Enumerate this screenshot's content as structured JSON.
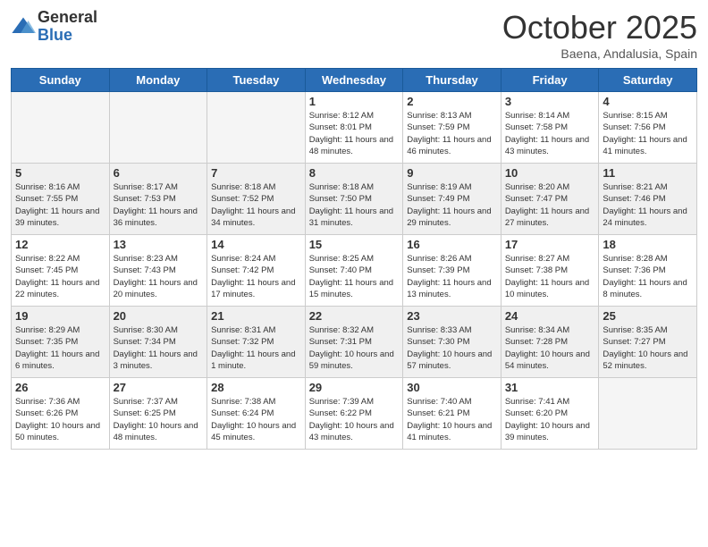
{
  "header": {
    "logo_general": "General",
    "logo_blue": "Blue",
    "month_title": "October 2025",
    "subtitle": "Baena, Andalusia, Spain"
  },
  "weekdays": [
    "Sunday",
    "Monday",
    "Tuesday",
    "Wednesday",
    "Thursday",
    "Friday",
    "Saturday"
  ],
  "weeks": [
    [
      {
        "day": "",
        "empty": true
      },
      {
        "day": "",
        "empty": true
      },
      {
        "day": "",
        "empty": true
      },
      {
        "day": "1",
        "sunrise": "8:12 AM",
        "sunset": "8:01 PM",
        "daylight": "11 hours and 48 minutes."
      },
      {
        "day": "2",
        "sunrise": "8:13 AM",
        "sunset": "7:59 PM",
        "daylight": "11 hours and 46 minutes."
      },
      {
        "day": "3",
        "sunrise": "8:14 AM",
        "sunset": "7:58 PM",
        "daylight": "11 hours and 43 minutes."
      },
      {
        "day": "4",
        "sunrise": "8:15 AM",
        "sunset": "7:56 PM",
        "daylight": "11 hours and 41 minutes."
      }
    ],
    [
      {
        "day": "5",
        "sunrise": "8:16 AM",
        "sunset": "7:55 PM",
        "daylight": "11 hours and 39 minutes."
      },
      {
        "day": "6",
        "sunrise": "8:17 AM",
        "sunset": "7:53 PM",
        "daylight": "11 hours and 36 minutes."
      },
      {
        "day": "7",
        "sunrise": "8:18 AM",
        "sunset": "7:52 PM",
        "daylight": "11 hours and 34 minutes."
      },
      {
        "day": "8",
        "sunrise": "8:18 AM",
        "sunset": "7:50 PM",
        "daylight": "11 hours and 31 minutes."
      },
      {
        "day": "9",
        "sunrise": "8:19 AM",
        "sunset": "7:49 PM",
        "daylight": "11 hours and 29 minutes."
      },
      {
        "day": "10",
        "sunrise": "8:20 AM",
        "sunset": "7:47 PM",
        "daylight": "11 hours and 27 minutes."
      },
      {
        "day": "11",
        "sunrise": "8:21 AM",
        "sunset": "7:46 PM",
        "daylight": "11 hours and 24 minutes."
      }
    ],
    [
      {
        "day": "12",
        "sunrise": "8:22 AM",
        "sunset": "7:45 PM",
        "daylight": "11 hours and 22 minutes."
      },
      {
        "day": "13",
        "sunrise": "8:23 AM",
        "sunset": "7:43 PM",
        "daylight": "11 hours and 20 minutes."
      },
      {
        "day": "14",
        "sunrise": "8:24 AM",
        "sunset": "7:42 PM",
        "daylight": "11 hours and 17 minutes."
      },
      {
        "day": "15",
        "sunrise": "8:25 AM",
        "sunset": "7:40 PM",
        "daylight": "11 hours and 15 minutes."
      },
      {
        "day": "16",
        "sunrise": "8:26 AM",
        "sunset": "7:39 PM",
        "daylight": "11 hours and 13 minutes."
      },
      {
        "day": "17",
        "sunrise": "8:27 AM",
        "sunset": "7:38 PM",
        "daylight": "11 hours and 10 minutes."
      },
      {
        "day": "18",
        "sunrise": "8:28 AM",
        "sunset": "7:36 PM",
        "daylight": "11 hours and 8 minutes."
      }
    ],
    [
      {
        "day": "19",
        "sunrise": "8:29 AM",
        "sunset": "7:35 PM",
        "daylight": "11 hours and 6 minutes."
      },
      {
        "day": "20",
        "sunrise": "8:30 AM",
        "sunset": "7:34 PM",
        "daylight": "11 hours and 3 minutes."
      },
      {
        "day": "21",
        "sunrise": "8:31 AM",
        "sunset": "7:32 PM",
        "daylight": "11 hours and 1 minute."
      },
      {
        "day": "22",
        "sunrise": "8:32 AM",
        "sunset": "7:31 PM",
        "daylight": "10 hours and 59 minutes."
      },
      {
        "day": "23",
        "sunrise": "8:33 AM",
        "sunset": "7:30 PM",
        "daylight": "10 hours and 57 minutes."
      },
      {
        "day": "24",
        "sunrise": "8:34 AM",
        "sunset": "7:28 PM",
        "daylight": "10 hours and 54 minutes."
      },
      {
        "day": "25",
        "sunrise": "8:35 AM",
        "sunset": "7:27 PM",
        "daylight": "10 hours and 52 minutes."
      }
    ],
    [
      {
        "day": "26",
        "sunrise": "7:36 AM",
        "sunset": "6:26 PM",
        "daylight": "10 hours and 50 minutes."
      },
      {
        "day": "27",
        "sunrise": "7:37 AM",
        "sunset": "6:25 PM",
        "daylight": "10 hours and 48 minutes."
      },
      {
        "day": "28",
        "sunrise": "7:38 AM",
        "sunset": "6:24 PM",
        "daylight": "10 hours and 45 minutes."
      },
      {
        "day": "29",
        "sunrise": "7:39 AM",
        "sunset": "6:22 PM",
        "daylight": "10 hours and 43 minutes."
      },
      {
        "day": "30",
        "sunrise": "7:40 AM",
        "sunset": "6:21 PM",
        "daylight": "10 hours and 41 minutes."
      },
      {
        "day": "31",
        "sunrise": "7:41 AM",
        "sunset": "6:20 PM",
        "daylight": "10 hours and 39 minutes."
      },
      {
        "day": "",
        "empty": true
      }
    ]
  ]
}
